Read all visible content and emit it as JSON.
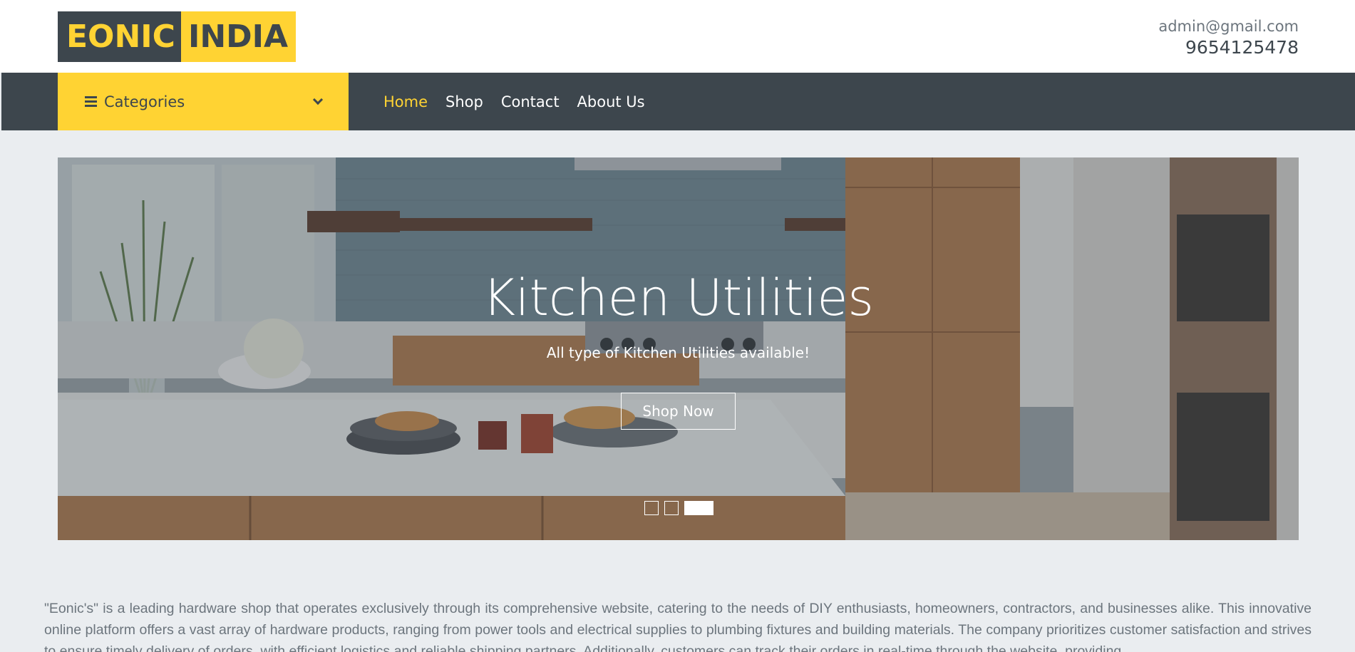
{
  "logo": {
    "part1": "EONIC",
    "part2": "INDIA"
  },
  "contact": {
    "email": "admin@gmail.com",
    "phone": "9654125478"
  },
  "nav": {
    "categories_label": "Categories",
    "links": [
      "Home",
      "Shop",
      "Contact",
      "About Us"
    ],
    "active": "Home"
  },
  "hero": {
    "title": "Kitchen Utilities",
    "subtitle": "All type of Kitchen Utilities available!",
    "button": "Shop Now",
    "slides": 3,
    "active_slide": 3
  },
  "about": {
    "text": "\"Eonic's\" is a leading hardware shop that operates exclusively through its comprehensive website, catering to the needs of DIY enthusiasts, homeowners, contractors, and businesses alike. This innovative online platform offers a vast array of hardware products, ranging from power tools and electrical supplies to plumbing fixtures and building materials. The company prioritizes customer satisfaction and strives to ensure timely delivery of orders, with efficient logistics and reliable shipping partners. Additionally, customers can track their orders in real-time through the website, providing"
  },
  "colors": {
    "dark": "#3d464d",
    "accent": "#ffd333",
    "background": "#eaedf0"
  },
  "icons": {
    "menu": "hamburger-icon",
    "dropdown": "chevron-down-icon"
  }
}
